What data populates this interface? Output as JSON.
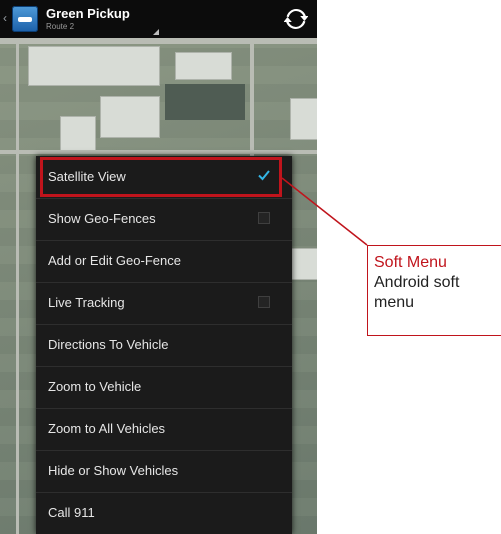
{
  "app_bar": {
    "title": "Green Pickup",
    "subtitle": "Route 2",
    "icon": "app-logo-icon",
    "refresh_icon": "refresh-icon",
    "back_icon": "back-chevron-icon"
  },
  "menu": {
    "items": [
      {
        "label": "Satellite View",
        "state": "checked"
      },
      {
        "label": "Show Geo-Fences",
        "state": "unchecked"
      },
      {
        "label": "Add or Edit Geo-Fence",
        "state": "none"
      },
      {
        "label": "Live Tracking",
        "state": "unchecked"
      },
      {
        "label": "Directions To Vehicle",
        "state": "none"
      },
      {
        "label": "Zoom to Vehicle",
        "state": "none"
      },
      {
        "label": "Zoom to All Vehicles",
        "state": "none"
      },
      {
        "label": "Hide or Show Vehicles",
        "state": "none"
      },
      {
        "label": "Call 911",
        "state": "none"
      }
    ]
  },
  "callout": {
    "title": "Soft Menu",
    "description": "Android soft menu"
  },
  "colors": {
    "accent": "#c0141c",
    "check": "#33b5e5",
    "menu_bg": "#1b1b1b",
    "app_bar_bg": "#0c0c0c"
  }
}
